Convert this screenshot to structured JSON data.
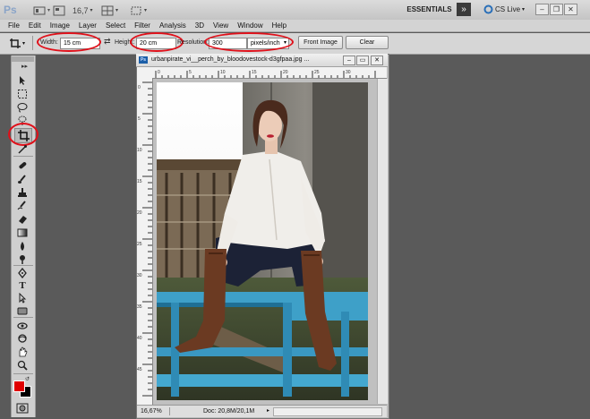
{
  "appbar": {
    "logo": "Ps",
    "zoom": "16,7",
    "workspace": "ESSENTIALS",
    "extend": "»",
    "cs_live": "CS Live"
  },
  "menu": [
    "File",
    "Edit",
    "Image",
    "Layer",
    "Select",
    "Filter",
    "Analysis",
    "3D",
    "View",
    "Window",
    "Help"
  ],
  "options": {
    "width_label": "Width:",
    "width_value": "15 cm",
    "height_label": "Height:",
    "height_value": "20 cm",
    "resolution_label": "Resolution:",
    "resolution_value": "300",
    "resolution_unit": "pixels/inch",
    "front_image": "Front Image",
    "clear": "Clear"
  },
  "document": {
    "title": "urbanpirate_vi__perch_by_bloodovestock-d3gfpaa.jpg ...",
    "zoom": "16,67%",
    "doc_size": "Doc: 20,8M/20,1M",
    "ruler_top_ticks": [
      "0",
      "5",
      "10",
      "15",
      "20",
      "25",
      "30"
    ],
    "ruler_left_ticks": [
      "0",
      "5",
      "10",
      "15",
      "20",
      "25",
      "30",
      "35",
      "40",
      "45"
    ]
  },
  "tools": {
    "foreground_color": "#e00000",
    "background_color": "#000000"
  },
  "colors": {
    "annotation": "#e0101a",
    "panel": "#cfcfcf",
    "workspace": "#5a5a5a"
  }
}
